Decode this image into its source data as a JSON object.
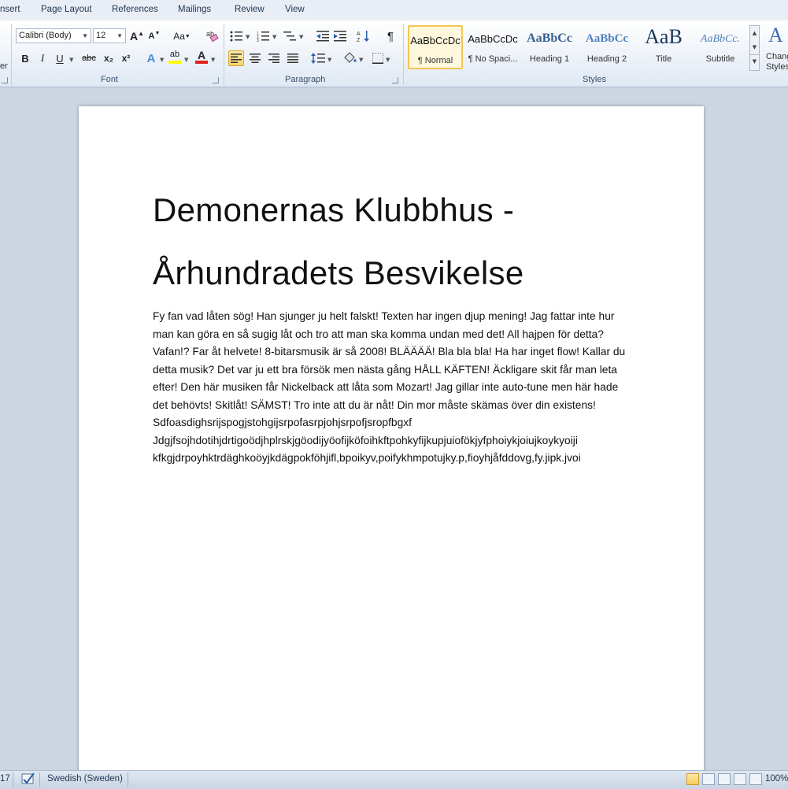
{
  "ribbon_tabs": [
    "nsert",
    "Page Layout",
    "References",
    "Mailings",
    "Review",
    "View"
  ],
  "clipboard": {
    "partial_label": "er"
  },
  "font": {
    "family": "Calibri (Body)",
    "size": "12",
    "group_label": "Font",
    "grow_glyph": "A",
    "shrink_glyph": "A",
    "case_glyph": "Aa",
    "bold": "B",
    "italic": "I",
    "underline": "U",
    "strike": "abc",
    "subscript": "x₂",
    "superscript": "x²",
    "effects_glyph": "A",
    "highlight_glyph": "ab",
    "color_glyph": "A"
  },
  "paragraph": {
    "group_label": "Paragraph",
    "pilcrow": "¶"
  },
  "styles": {
    "group_label": "Styles",
    "items": [
      {
        "sample": "AaBbCcDc",
        "name": "¶ Normal",
        "selected": true
      },
      {
        "sample": "AaBbCcDc",
        "name": "¶ No Spaci...",
        "selected": false
      },
      {
        "sample": "AaBbCc",
        "name": "Heading 1",
        "selected": false
      },
      {
        "sample": "AaBbCc",
        "name": "Heading 2",
        "selected": false
      },
      {
        "sample": "AaB",
        "name": "Title",
        "selected": false
      },
      {
        "sample": "AaBbCc.",
        "name": "Subtitle",
        "selected": false
      }
    ],
    "change_styles_line1": "Chang",
    "change_styles_line2": "Styles"
  },
  "document": {
    "title_line1": "Demonernas Klubbhus -",
    "title_line2": "Århundradets Besvikelse",
    "body": "Fy fan vad låten sög! Han sjunger ju helt falskt! Texten har ingen djup mening! Jag fattar inte hur man kan göra en så sugig låt och tro att man ska komma undan med det! All hajpen för detta? Vafan!? Far åt helvete! 8-bitarsmusik är så 2008! BLÄÄÄÄ! Bla bla bla! Ha har inget flow! Kallar du detta musik? Det var ju ett bra försök men nästa gång HÅLL KÄFTEN! Äckligare skit får man leta efter! Den här musiken får Nickelback att låta som Mozart! Jag gillar inte auto-tune men här hade det behövts! Skitlåt! SÄMST! Tro inte att du är nåt! Din mor måste skämas över din existens! Sdfoasdighsrijspogjstohgijsrpofasrpjohjsrpofjsropfbgxf Jdgjfsojhdotihjdrtigoödjhplrskjgöodijyöofijköfoihkftpohkyfijkupjuiofökjyfphoiykjoiujkoykyoiji kfkgjdrpoyhktrdäghkoöyjkdägpokföhjifl,bpoikyv,poifykhmpotujky.p,fioyhjåfddovg,fy.jipk.jvoi"
  },
  "status_bar": {
    "page_fragment": "17",
    "language": "Swedish (Sweden)",
    "zoom": "100%"
  },
  "colors": {
    "highlight_yellow": "#ffff00",
    "font_color_red": "#e0201b",
    "selected_style_border": "#f2c654",
    "heading_blue": "#365f91"
  }
}
